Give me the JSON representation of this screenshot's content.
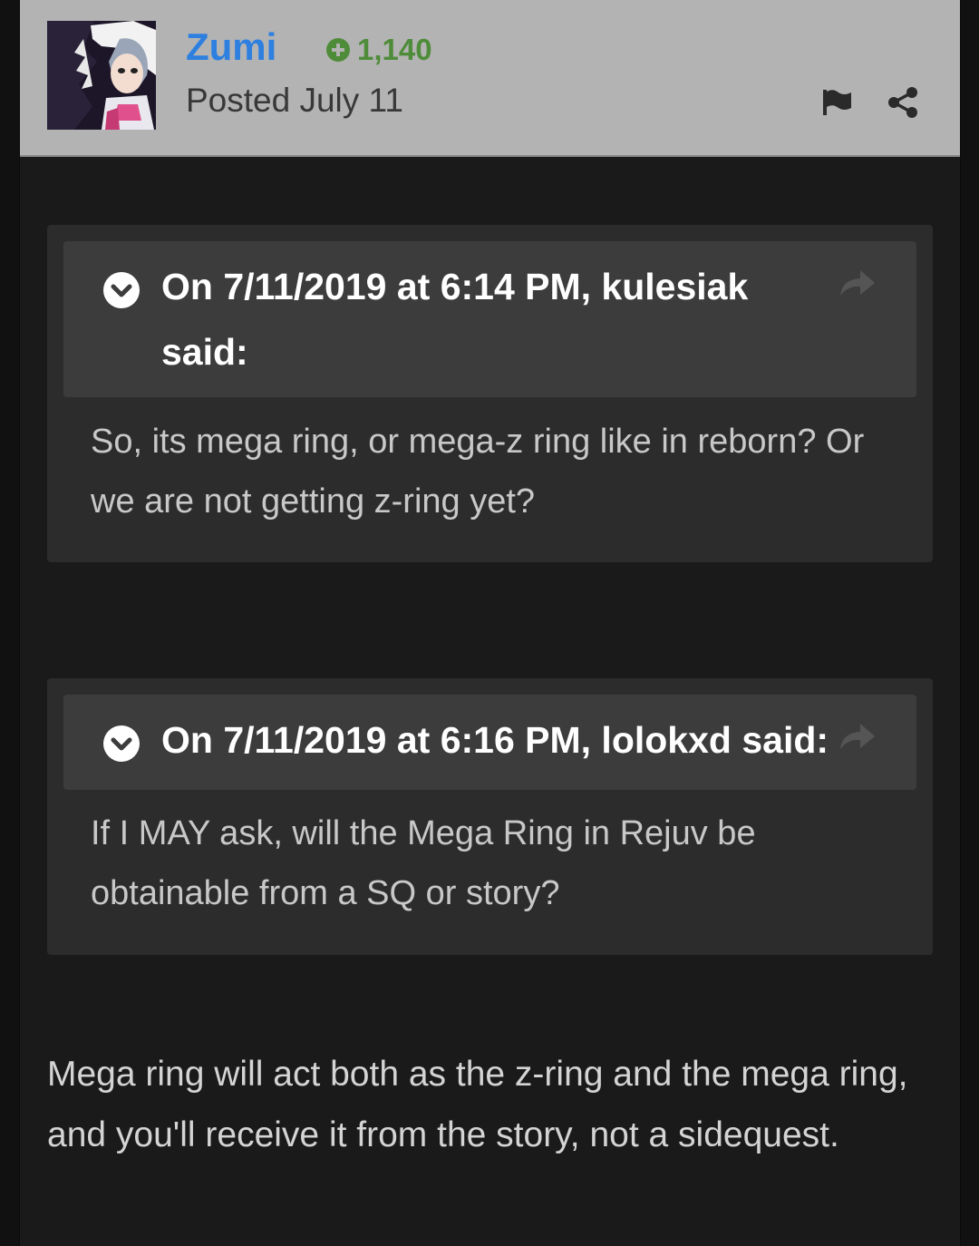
{
  "author": {
    "username": "Zumi",
    "reputation": "1,140",
    "posted": "Posted July 11"
  },
  "quotes": [
    {
      "citation": "On 7/11/2019 at 6:14 PM, kulesiak said:",
      "body": "So, its mega ring, or mega-z ring like in reborn? Or we are not getting z-ring yet?"
    },
    {
      "citation": "On 7/11/2019 at 6:16 PM, lolokxd said:",
      "body": "If I MAY ask, will the Mega Ring in Rejuv be obtainable from a SQ or story?"
    }
  ],
  "reply": "Mega ring will act both as the z-ring and the mega ring, and you'll receive it from the story, not a sidequest.",
  "icons": {
    "reputation": "plus-circle-icon",
    "report": "flag-icon",
    "share": "share-icon",
    "expand": "chevron-down-icon",
    "go_to_quoted": "share-arrow-icon"
  },
  "colors": {
    "username": "#2d7fe0",
    "reputation": "#4f8c3a",
    "header_bg": "#b3b3b3",
    "page_bg": "#1a1a1a"
  }
}
